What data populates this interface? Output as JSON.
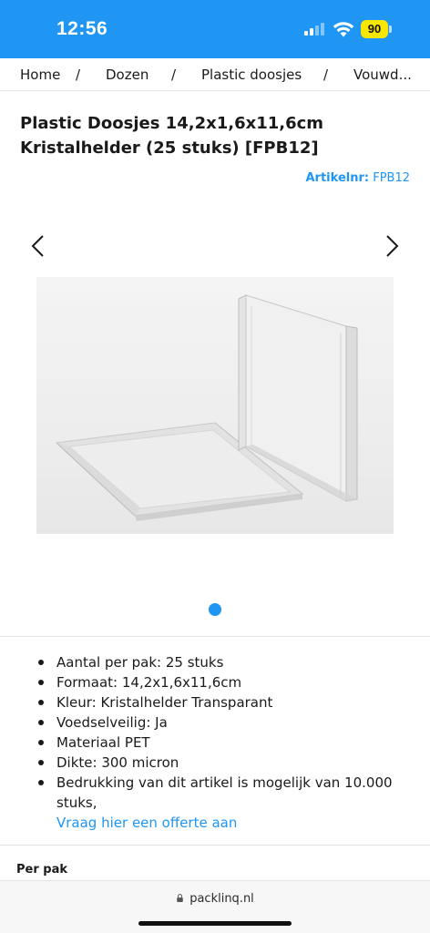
{
  "status_bar": {
    "time": "12:56",
    "battery": "90",
    "colors": {
      "background": "#1f96f3",
      "battery": "#f7e600"
    }
  },
  "breadcrumb": {
    "items": [
      "Home",
      "Dozen",
      "Plastic doosjes",
      "Vouwd..."
    ],
    "separator": "/"
  },
  "product": {
    "title_line1": "Plastic Doosjes 14,2x1,6x11,6cm",
    "title_line2": "Kristalhelder (25 stuks) [FPB12]",
    "sku_label": "Artikelnr:",
    "sku_value": "FPB12"
  },
  "gallery": {
    "prev_icon": "chevron-left-icon",
    "next_icon": "chevron-right-icon",
    "image_subject": "clear plastic box",
    "active_dot": 1,
    "dot_count": 1
  },
  "specs": [
    "Aantal per pak: 25 stuks",
    "Formaat: 14,2x1,6x11,6cm",
    "Kleur: Kristalhelder Transparant",
    "Voedselveilig: Ja",
    "Materiaal PET",
    "Dikte: 300 micron",
    "Bedrukking van dit artikel is mogelijk van 10.000 stuks,"
  ],
  "specs_link": "Vraag hier een offerte aan",
  "pricing": {
    "per_pak_label": "Per pak"
  },
  "browser": {
    "url": "packlinq.nl",
    "lock_icon": "lock-icon"
  },
  "colors": {
    "accent": "#1f96f3",
    "text": "#1a1a1a"
  }
}
